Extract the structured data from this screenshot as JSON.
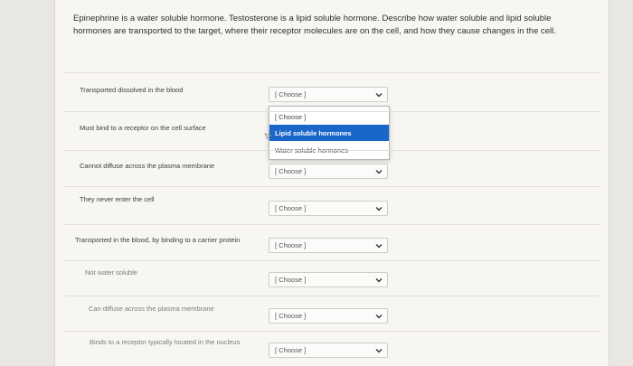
{
  "question": "Epinephrine is a water soluble hormone. Testosterone is a lipid soluble hormone. Describe how water soluble and lipid soluble hormones are transported to the target, where their receptor molecules are on the cell, and how they cause changes in the cell.",
  "rows": [
    {
      "label": "Transported dissolved in the blood",
      "select": "[ Choose ]"
    },
    {
      "label": "Must bind to a receptor on the cell surface",
      "select": ""
    },
    {
      "label": "Cannot diffuse across the plasma membrane",
      "select": "[ Choose ]"
    },
    {
      "label": "They never enter the cell",
      "select": "[ Choose ]"
    },
    {
      "label": "Transported in the blood, by binding to a carrier protein",
      "select": "[ Choose ]"
    },
    {
      "label": "Not water soluble",
      "select": "[ Choose ]"
    },
    {
      "label": "Can diffuse across the plasma membrane",
      "select": "[ Choose ]"
    },
    {
      "label": "Binds to a receptor typically located in the nucleus",
      "select": "[ Choose ]"
    }
  ],
  "dropdown": {
    "options": [
      "[ Choose ]",
      "Lipid soluble hormones",
      "Water soluble hormones"
    ],
    "highlighted": "Lipid soluble hormones"
  },
  "colors": {
    "highlight": "#1a66c9",
    "background": "#f7f6f3"
  }
}
